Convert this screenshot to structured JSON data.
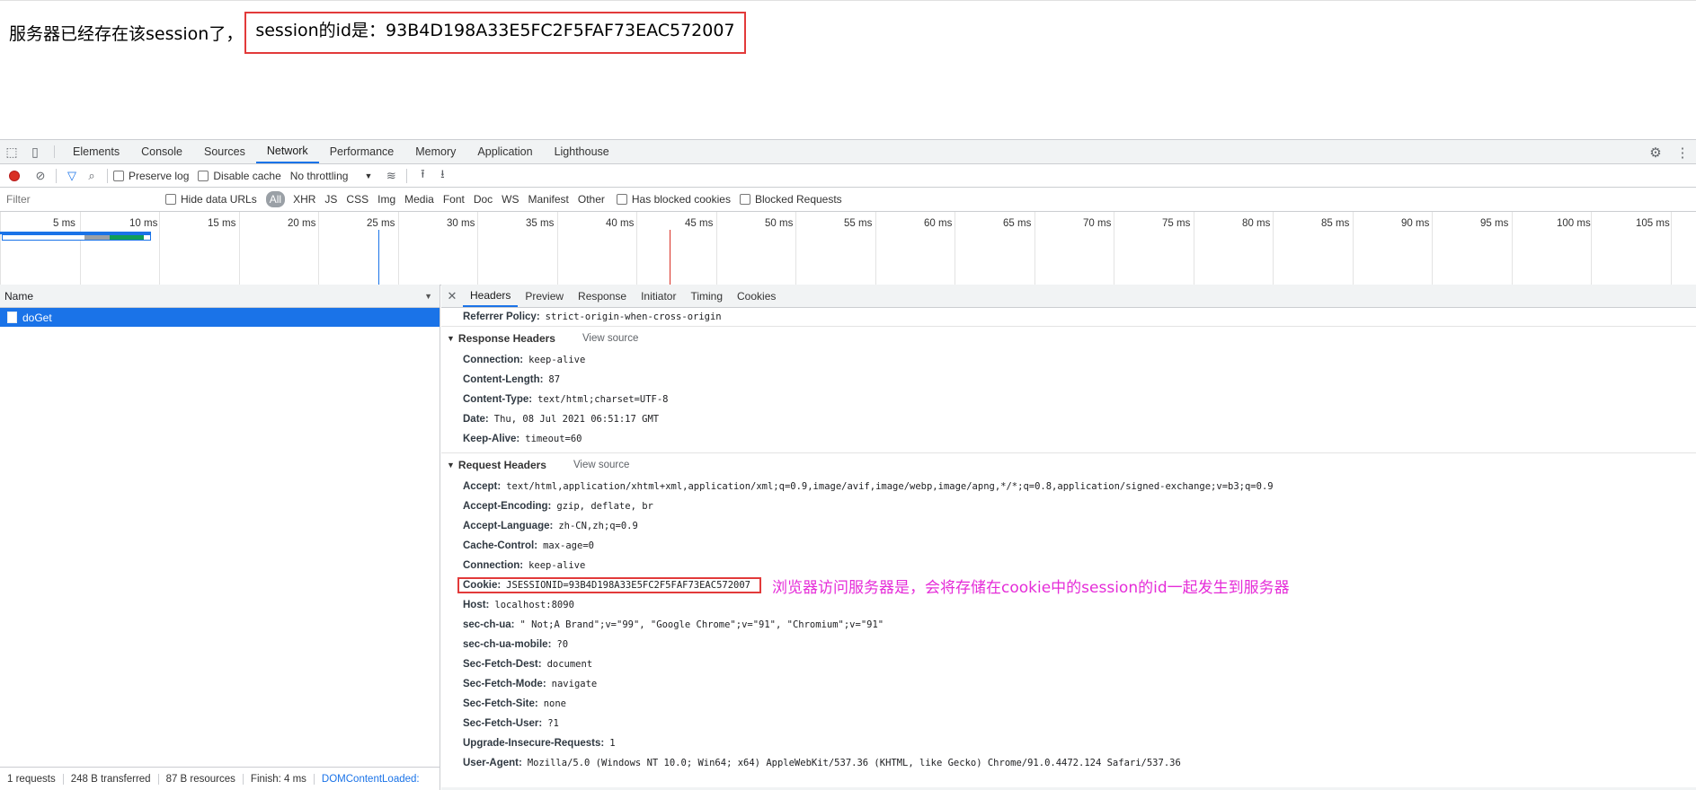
{
  "page": {
    "message_prefix": "服务器已经存在该session了，",
    "message_highlight": "session的id是：93B4D198A33E5FC2F5FAF73EAC572007"
  },
  "devtools": {
    "tabs": [
      "Elements",
      "Console",
      "Sources",
      "Network",
      "Performance",
      "Memory",
      "Application",
      "Lighthouse"
    ],
    "active_tab": "Network",
    "toolbar": {
      "preserve_log": "Preserve log",
      "disable_cache": "Disable cache",
      "throttling": "No throttling"
    },
    "filterbar": {
      "filter_placeholder": "Filter",
      "hide_data_urls": "Hide data URLs",
      "types": [
        "All",
        "XHR",
        "JS",
        "CSS",
        "Img",
        "Media",
        "Font",
        "Doc",
        "WS",
        "Manifest",
        "Other"
      ],
      "has_blocked_cookies": "Has blocked cookies",
      "blocked_requests": "Blocked Requests"
    },
    "timeline": {
      "ticks": [
        "5 ms",
        "10 ms",
        "15 ms",
        "20 ms",
        "25 ms",
        "30 ms",
        "35 ms",
        "40 ms",
        "45 ms",
        "50 ms",
        "55 ms",
        "60 ms",
        "65 ms",
        "70 ms",
        "75 ms",
        "80 ms",
        "85 ms",
        "90 ms",
        "95 ms",
        "100 ms",
        "105 ms"
      ]
    },
    "requests": {
      "column_name": "Name",
      "rows": [
        "doGet"
      ]
    },
    "status": {
      "requests": "1 requests",
      "transferred": "248 B transferred",
      "resources": "87 B resources",
      "finish": "Finish: 4 ms",
      "dcl": "DOMContentLoaded:"
    },
    "detail_tabs": [
      "Headers",
      "Preview",
      "Response",
      "Initiator",
      "Timing",
      "Cookies"
    ],
    "referrer": {
      "k": "Referrer Policy:",
      "v": "strict-origin-when-cross-origin"
    },
    "response_headers_title": "Response Headers",
    "request_headers_title": "Request Headers",
    "view_source": "View source",
    "response_headers": [
      {
        "k": "Connection:",
        "v": "keep-alive"
      },
      {
        "k": "Content-Length:",
        "v": "87"
      },
      {
        "k": "Content-Type:",
        "v": "text/html;charset=UTF-8"
      },
      {
        "k": "Date:",
        "v": "Thu, 08 Jul 2021 06:51:17 GMT"
      },
      {
        "k": "Keep-Alive:",
        "v": "timeout=60"
      }
    ],
    "request_headers_before": [
      {
        "k": "Accept:",
        "v": "text/html,application/xhtml+xml,application/xml;q=0.9,image/avif,image/webp,image/apng,*/*;q=0.8,application/signed-exchange;v=b3;q=0.9"
      },
      {
        "k": "Accept-Encoding:",
        "v": "gzip, deflate, br"
      },
      {
        "k": "Accept-Language:",
        "v": "zh-CN,zh;q=0.9"
      },
      {
        "k": "Cache-Control:",
        "v": "max-age=0"
      },
      {
        "k": "Connection:",
        "v": "keep-alive"
      }
    ],
    "cookie": {
      "k": "Cookie:",
      "v": "JSESSIONID=93B4D198A33E5FC2F5FAF73EAC572007"
    },
    "annotation": "浏览器访问服务器是，会将存储在cookie中的session的id一起发生到服务器",
    "request_headers_after": [
      {
        "k": "Host:",
        "v": "localhost:8090"
      },
      {
        "k": "sec-ch-ua:",
        "v": "\" Not;A Brand\";v=\"99\", \"Google Chrome\";v=\"91\", \"Chromium\";v=\"91\""
      },
      {
        "k": "sec-ch-ua-mobile:",
        "v": "?0"
      },
      {
        "k": "Sec-Fetch-Dest:",
        "v": "document"
      },
      {
        "k": "Sec-Fetch-Mode:",
        "v": "navigate"
      },
      {
        "k": "Sec-Fetch-Site:",
        "v": "none"
      },
      {
        "k": "Sec-Fetch-User:",
        "v": "?1"
      },
      {
        "k": "Upgrade-Insecure-Requests:",
        "v": "1"
      },
      {
        "k": "User-Agent:",
        "v": "Mozilla/5.0 (Windows NT 10.0; Win64; x64) AppleWebKit/537.36 (KHTML, like Gecko) Chrome/91.0.4472.124 Safari/537.36"
      }
    ]
  },
  "colors": {
    "accent": "#1a73e8",
    "highlight_box": "#e23a3a",
    "annotation": "#e52cd8"
  }
}
